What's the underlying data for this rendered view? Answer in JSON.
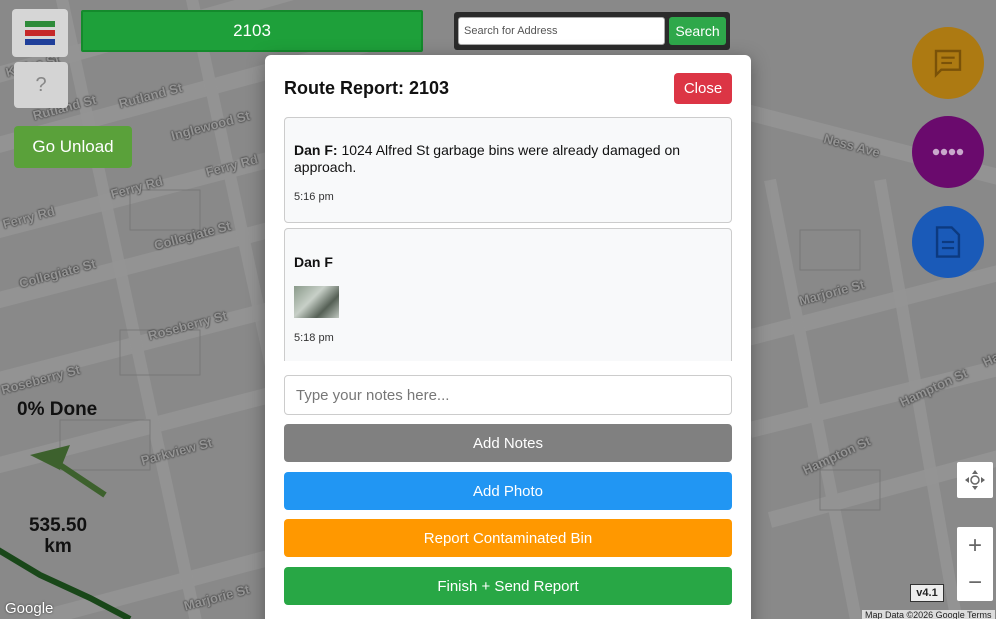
{
  "header": {
    "route_number": "2103",
    "search_placeholder": "Search for Address",
    "search_label": "Search",
    "help_label": "?",
    "unload_label": "Go Unload"
  },
  "status": {
    "progress_label": "0% Done",
    "distance_value": "535.50",
    "distance_unit": "km",
    "version": "v4.1",
    "google_label": "Google",
    "map_attribution": "Map Data ©2026 Google   Terms"
  },
  "colors": {
    "chat_fab": "#ad7a12",
    "more_fab": "#6a0a6d",
    "report_fab": "#1a5ab8"
  },
  "streets": [
    "Kylies St",
    "Rutland St",
    "Rutland St",
    "Inglewood St",
    "Ferry Rd",
    "Ferry Rd",
    "Ferry Rd",
    "Collegiate St",
    "Collegiate St",
    "Roseberry St",
    "Roseberry St",
    "Parkview St",
    "Marjorie St",
    "Marjorie St",
    "Hampton St",
    "Hampton St",
    "Ness Ave",
    "Hampton St"
  ],
  "modal": {
    "title": "Route Report: 2103",
    "close_label": "Close",
    "messages": [
      {
        "author": "Dan F:",
        "text": "1024 Alfred St garbage bins were already damaged on approach.",
        "time": "5:16 pm"
      },
      {
        "author": "Dan F",
        "time": "5:18 pm"
      }
    ],
    "notes_placeholder": "Type your notes here...",
    "buttons": {
      "add_notes": "Add Notes",
      "add_photo": "Add Photo",
      "report_contaminated": "Report Contaminated Bin",
      "finish_send": "Finish + Send Report"
    },
    "button_colors": {
      "add_notes": "#808080",
      "add_photo": "#2196f3",
      "report_contaminated": "#ff9800",
      "finish_send": "#28a745"
    }
  }
}
